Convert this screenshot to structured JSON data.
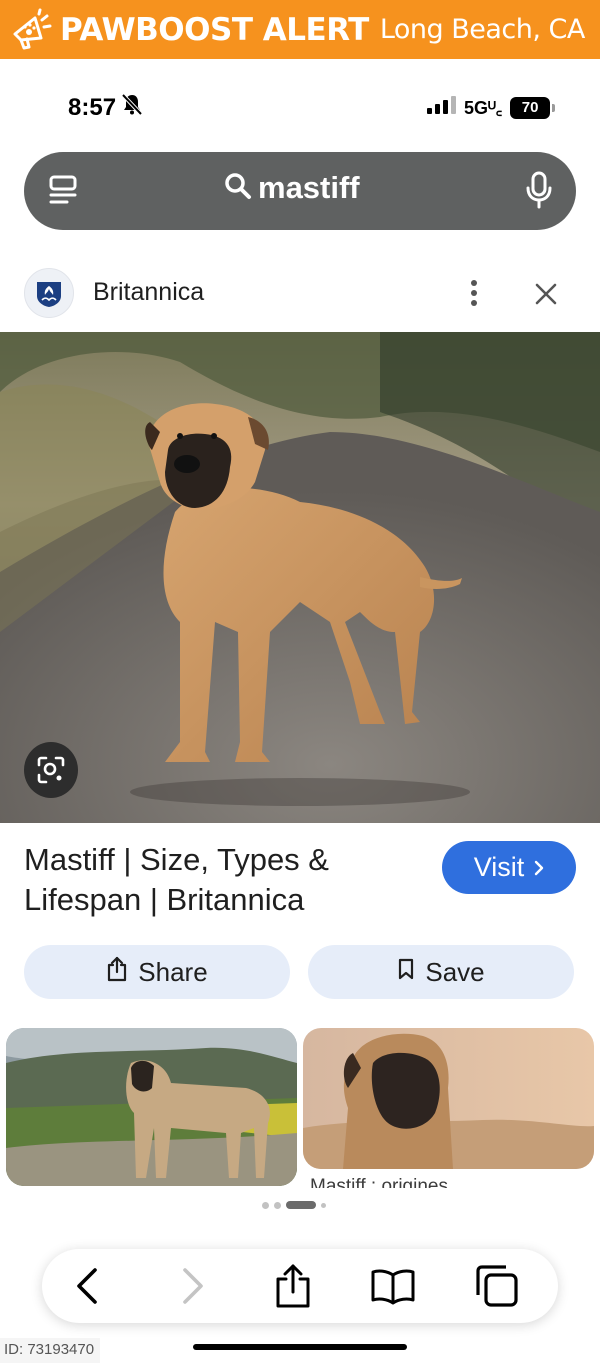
{
  "banner": {
    "title": "PAWBOOST ALERT",
    "location": "Long Beach, CA",
    "color": "#f6921e",
    "icon": "megaphone-paw-icon"
  },
  "status_bar": {
    "time": "8:57",
    "network": "5Gᵁ꜀",
    "battery": "70",
    "icons": [
      "bell-slash-icon",
      "signal-bars-icon",
      "battery-icon"
    ]
  },
  "search": {
    "query": "mastiff",
    "icons": [
      "tabs-icon",
      "search-icon",
      "mic-icon"
    ]
  },
  "source": {
    "name": "Britannica",
    "icons": [
      "britannica-logo",
      "more-vert-icon",
      "close-icon"
    ]
  },
  "result": {
    "title": "Mastiff | Size, Types & Lifespan | Britannica",
    "visit_label": "Visit",
    "share_label": "Share",
    "save_label": "Save",
    "visit_color": "#2f6fde"
  },
  "thumbnails": {
    "second_caption": "Mastiff : origines"
  },
  "toolbar": {
    "icons": [
      "back-icon",
      "forward-icon",
      "share-icon",
      "bookmarks-icon",
      "tabs-icon"
    ]
  },
  "footer": {
    "id": "ID: 73193470"
  }
}
